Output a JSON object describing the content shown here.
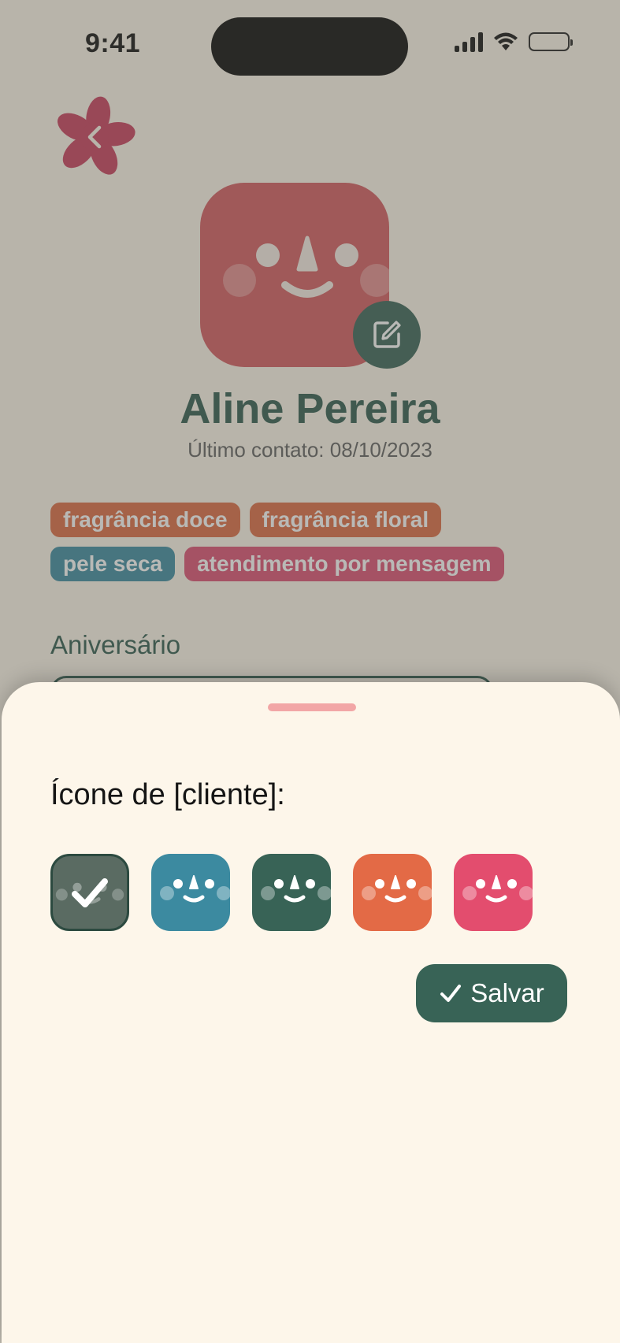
{
  "status_bar": {
    "time": "9:41"
  },
  "profile": {
    "name": "Aline Pereira",
    "last_contact": "Último contato: 08/10/2023",
    "avatar_color": "#d45a5f"
  },
  "tags": [
    {
      "label": "fragrância doce",
      "color": "#dc6a42"
    },
    {
      "label": "fragrância floral",
      "color": "#dc6a42"
    },
    {
      "label": "pele seca",
      "color": "#3c8aa0"
    },
    {
      "label": "atendimento por mensagem",
      "color": "#dc4f72"
    }
  ],
  "sections": {
    "birthday_label": "Aniversário"
  },
  "sheet": {
    "title": "Ícone de [cliente]:",
    "icon_options": [
      {
        "color": "#5a6b62",
        "selected": true
      },
      {
        "color": "#3c8aa0",
        "selected": false
      },
      {
        "color": "#386356",
        "selected": false
      },
      {
        "color": "#e36a46",
        "selected": false
      },
      {
        "color": "#e34d6e",
        "selected": false
      }
    ],
    "save_label": "Salvar"
  },
  "icons": {
    "back": "flower-back-icon",
    "edit": "edit-icon",
    "check": "check-icon"
  }
}
